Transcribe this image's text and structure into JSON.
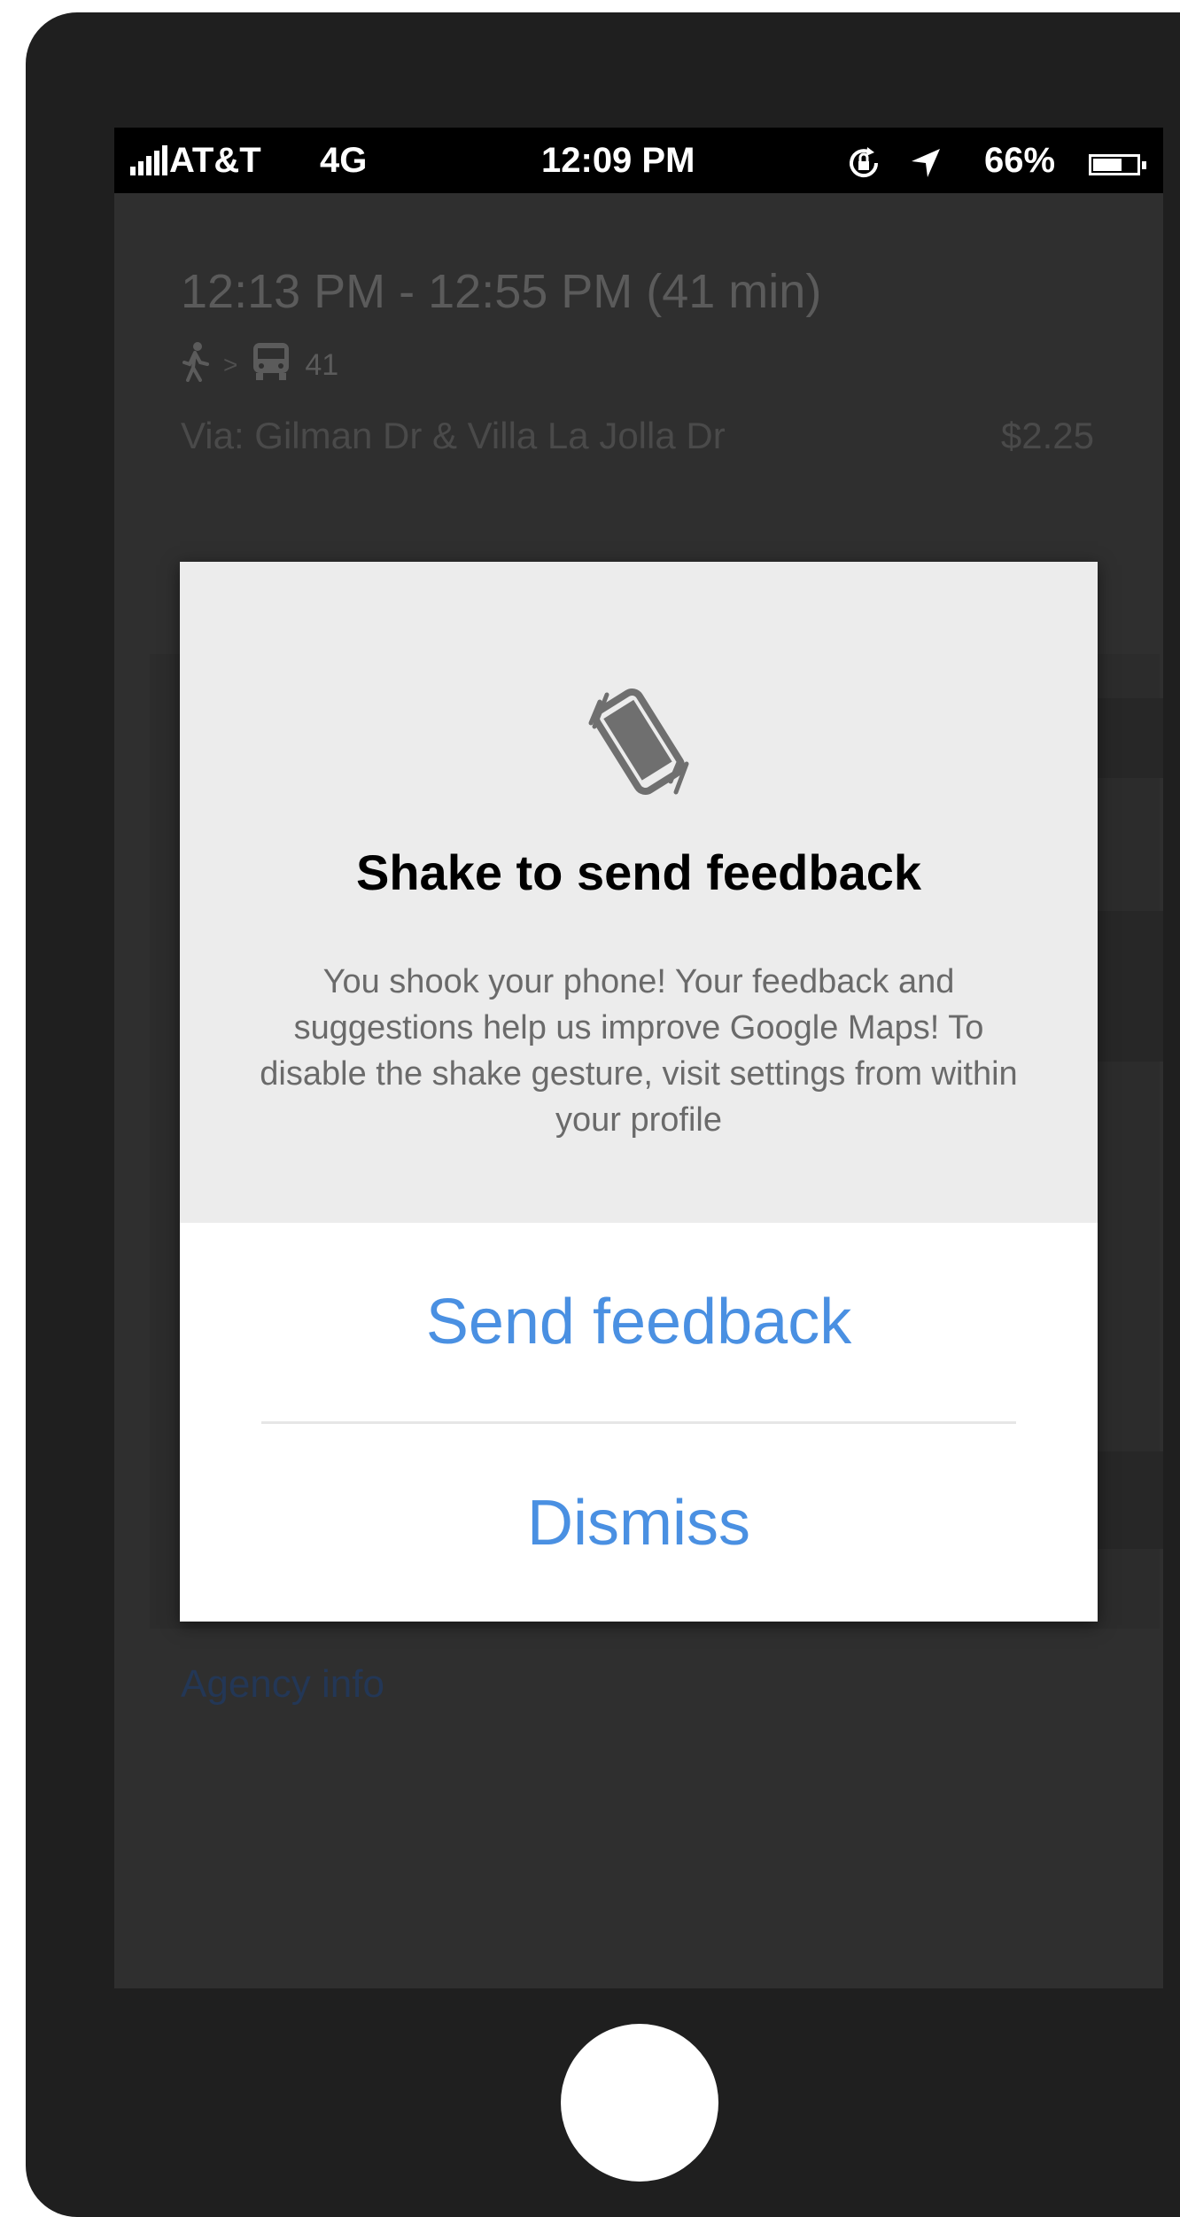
{
  "status_bar": {
    "carrier": "AT&T",
    "network": "4G",
    "time": "12:09 PM",
    "battery": "66%",
    "icons": [
      "signal-icon",
      "rotation-lock-icon",
      "location-arrow-icon",
      "battery-icon"
    ]
  },
  "trip": {
    "time_range": "12:13 PM - 12:55 PM (41 min)",
    "bus_route": "41",
    "via": "Via: Gilman Dr & Villa La Jolla Dr",
    "fare": "$2.25",
    "agency_link": "Agency info"
  },
  "dialog": {
    "icon": "shake-phone-icon",
    "title": "Shake to send feedback",
    "body": "You shook your phone! Your feedback and suggestions help us improve Google Maps! To disable the shake gesture, visit settings from within your profile",
    "send_label": "Send feedback",
    "dismiss_label": "Dismiss"
  },
  "colors": {
    "accent": "#4a90e2",
    "device": "#1f1f1f",
    "dialog_header": "#ececec"
  }
}
